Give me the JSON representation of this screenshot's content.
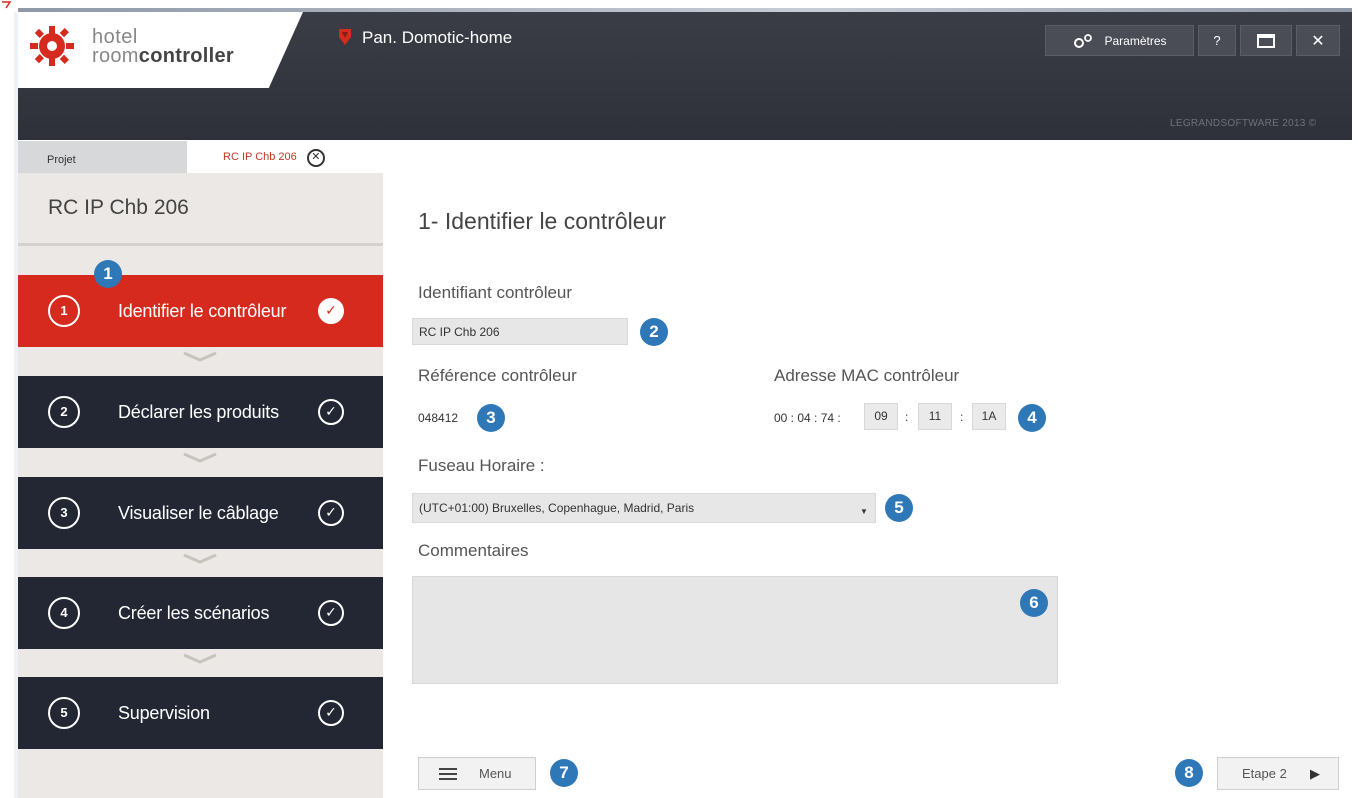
{
  "brand": {
    "line1": "hotel",
    "line2_light": "room",
    "line2_bold": "controller"
  },
  "header": {
    "title": "Pan. Domotic-home",
    "settings_label": "Paramètres",
    "help_label": "?",
    "close_label": "✕",
    "copyright": "LEGRANDSOFTWARE 2013 ©"
  },
  "tabs": [
    {
      "label": "Projet"
    },
    {
      "label": "RC IP Chb 206",
      "close": "✕"
    }
  ],
  "sidebar": {
    "title": "RC IP Chb 206",
    "steps": [
      {
        "num": "1",
        "label": "Identifier le contrôleur",
        "check": "✓"
      },
      {
        "num": "2",
        "label": "Déclarer les produits",
        "check": "✓"
      },
      {
        "num": "3",
        "label": "Visualiser le câblage",
        "check": "✓"
      },
      {
        "num": "4",
        "label": "Créer les scénarios",
        "check": "✓"
      },
      {
        "num": "5",
        "label": "Supervision",
        "check": "✓"
      }
    ]
  },
  "main": {
    "title": "1- Identifier le contrôleur",
    "identifiant_label": "Identifiant contrôleur",
    "identifiant_value": "RC IP Chb 206",
    "reference_label": "Référence contrôleur",
    "reference_value": "048412",
    "mac_label": "Adresse MAC contrôleur",
    "mac_prefix": "00 : 04 : 74 :",
    "mac_parts": [
      "09",
      "11",
      "1A"
    ],
    "mac_sep": ":",
    "fuseau_label": "Fuseau Horaire :",
    "fuseau_value": "(UTC+01:00) Bruxelles, Copenhague, Madrid, Paris",
    "commentaires_label": "Commentaires",
    "commentaires_value": ""
  },
  "footer": {
    "menu_label": "Menu",
    "next_label": "Etape 2",
    "next_arrow": "▶"
  },
  "callouts": [
    "1",
    "2",
    "3",
    "4",
    "5",
    "6",
    "7",
    "8"
  ],
  "colors": {
    "accent": "#d52a1d",
    "dark": "#232733",
    "callout": "#2e78b8"
  }
}
